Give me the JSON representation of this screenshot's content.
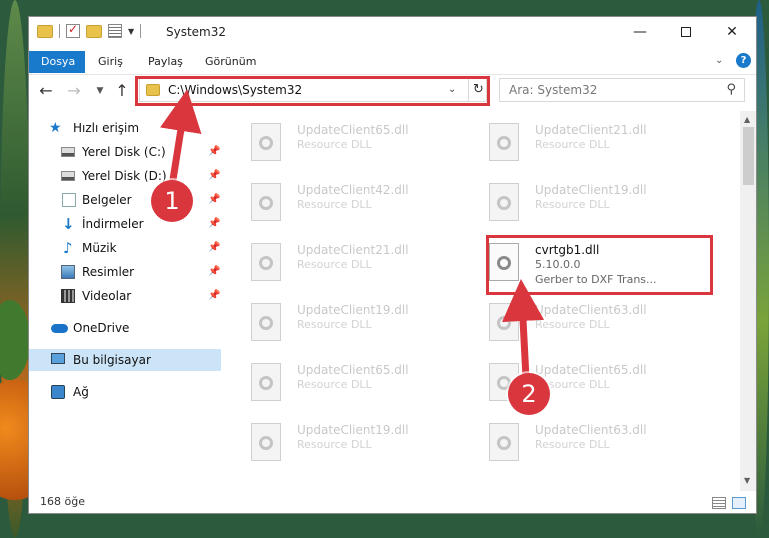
{
  "window": {
    "title": "System32",
    "controls": {
      "minimize": "—",
      "maximize": "",
      "close": "✕"
    }
  },
  "ribbon": {
    "tabs": [
      "Dosya",
      "Giriş",
      "Paylaş",
      "Görünüm"
    ],
    "help": "?"
  },
  "navigation": {
    "address_path": "C:\\Windows\\System32",
    "search_placeholder": "Ara: System32"
  },
  "sidebar": {
    "items": [
      {
        "label": "Hızlı erişim",
        "icon": "star-icon",
        "pinned": false
      },
      {
        "label": "Yerel Disk (C:)",
        "icon": "drive-icon",
        "pinned": true
      },
      {
        "label": "Yerel Disk (D:)",
        "icon": "drive-icon",
        "pinned": true
      },
      {
        "label": "Belgeler",
        "icon": "document-icon",
        "pinned": true
      },
      {
        "label": "İndirmeler",
        "icon": "download-icon",
        "pinned": true
      },
      {
        "label": "Müzik",
        "icon": "music-icon",
        "pinned": true
      },
      {
        "label": "Resimler",
        "icon": "pictures-icon",
        "pinned": true
      },
      {
        "label": "Videolar",
        "icon": "video-icon",
        "pinned": true
      },
      {
        "label": "OneDrive",
        "icon": "cloud-icon",
        "pinned": false
      },
      {
        "label": "Bu bilgisayar",
        "icon": "computer-icon",
        "pinned": false,
        "selected": true
      },
      {
        "label": "Ağ",
        "icon": "network-icon",
        "pinned": false
      }
    ]
  },
  "files": [
    {
      "name": "UpdateClient65.dll",
      "type": "Resource DLL",
      "desc": ""
    },
    {
      "name": "UpdateClient21.dll",
      "type": "Resource DLL",
      "desc": ""
    },
    {
      "name": "UpdateClient42.dll",
      "type": "Resource DLL",
      "desc": ""
    },
    {
      "name": "UpdateClient19.dll",
      "type": "Resource DLL",
      "desc": ""
    },
    {
      "name": "UpdateClient21.dll",
      "type": "Resource DLL",
      "desc": ""
    },
    {
      "name": "cvrtgb1.dll",
      "type": "5.10.0.0",
      "desc": "Gerber to DXF Trans...",
      "highlighted": true
    },
    {
      "name": "UpdateClient19.dll",
      "type": "Resource DLL",
      "desc": ""
    },
    {
      "name": "UpdateClient63.dll",
      "type": "Resource DLL",
      "desc": ""
    },
    {
      "name": "UpdateClient65.dll",
      "type": "Resource DLL",
      "desc": ""
    },
    {
      "name": "UpdateClient65.dll",
      "type": "Resource DLL",
      "desc": ""
    },
    {
      "name": "UpdateClient19.dll",
      "type": "Resource DLL",
      "desc": ""
    },
    {
      "name": "UpdateClient63.dll",
      "type": "Resource DLL",
      "desc": ""
    }
  ],
  "status": {
    "item_count": "168 öğe"
  },
  "annotations": {
    "step1": "1",
    "step2": "2",
    "color": "#d9363e"
  }
}
